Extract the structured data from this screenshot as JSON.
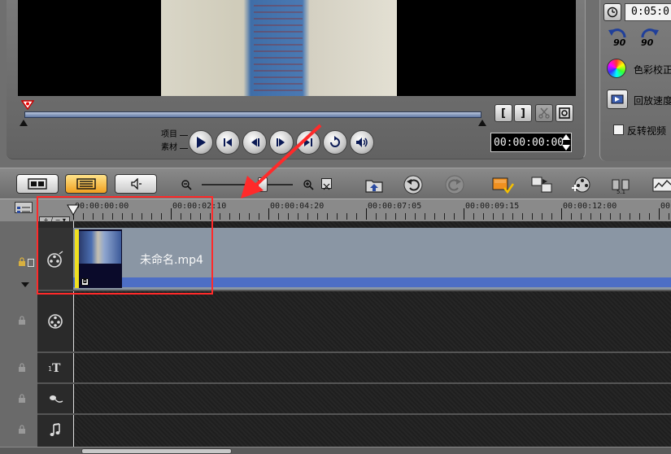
{
  "preview": {
    "mode_project": "项目",
    "mode_clip": "素材",
    "timecode": "00:00:00:00",
    "mark_in_label": "[",
    "mark_out_label": "]"
  },
  "options": {
    "duration": "0:05:0",
    "rotate_left_label": "90",
    "rotate_right_label": "90",
    "color_correction": "色彩校正",
    "playback_speed": "回放速度",
    "reverse_video": "反转视频"
  },
  "timeline": {
    "ruler_labels": [
      "00:00:00:00",
      "00:00:02:10",
      "00:00:04:20",
      "00:00:07:05",
      "00:00:09:15",
      "00:00:12:00",
      "00:00"
    ],
    "clip_name": "未命名.mp4"
  },
  "colors": {
    "annotation": "#ff2a2a",
    "clip_edge": "#f0e020",
    "track_blue": "#4d6ec5"
  },
  "icons": [
    "play-icon",
    "home-icon",
    "step-back-icon",
    "step-forward-icon",
    "end-icon",
    "repeat-icon",
    "volume-icon",
    "cut-icon",
    "fit-icon",
    "zoom-out-icon",
    "zoom-in-icon",
    "import-icon",
    "undo-icon",
    "redo-icon",
    "lock-icon",
    "film-reel-icon",
    "title-icon",
    "voice-icon",
    "music-icon"
  ]
}
